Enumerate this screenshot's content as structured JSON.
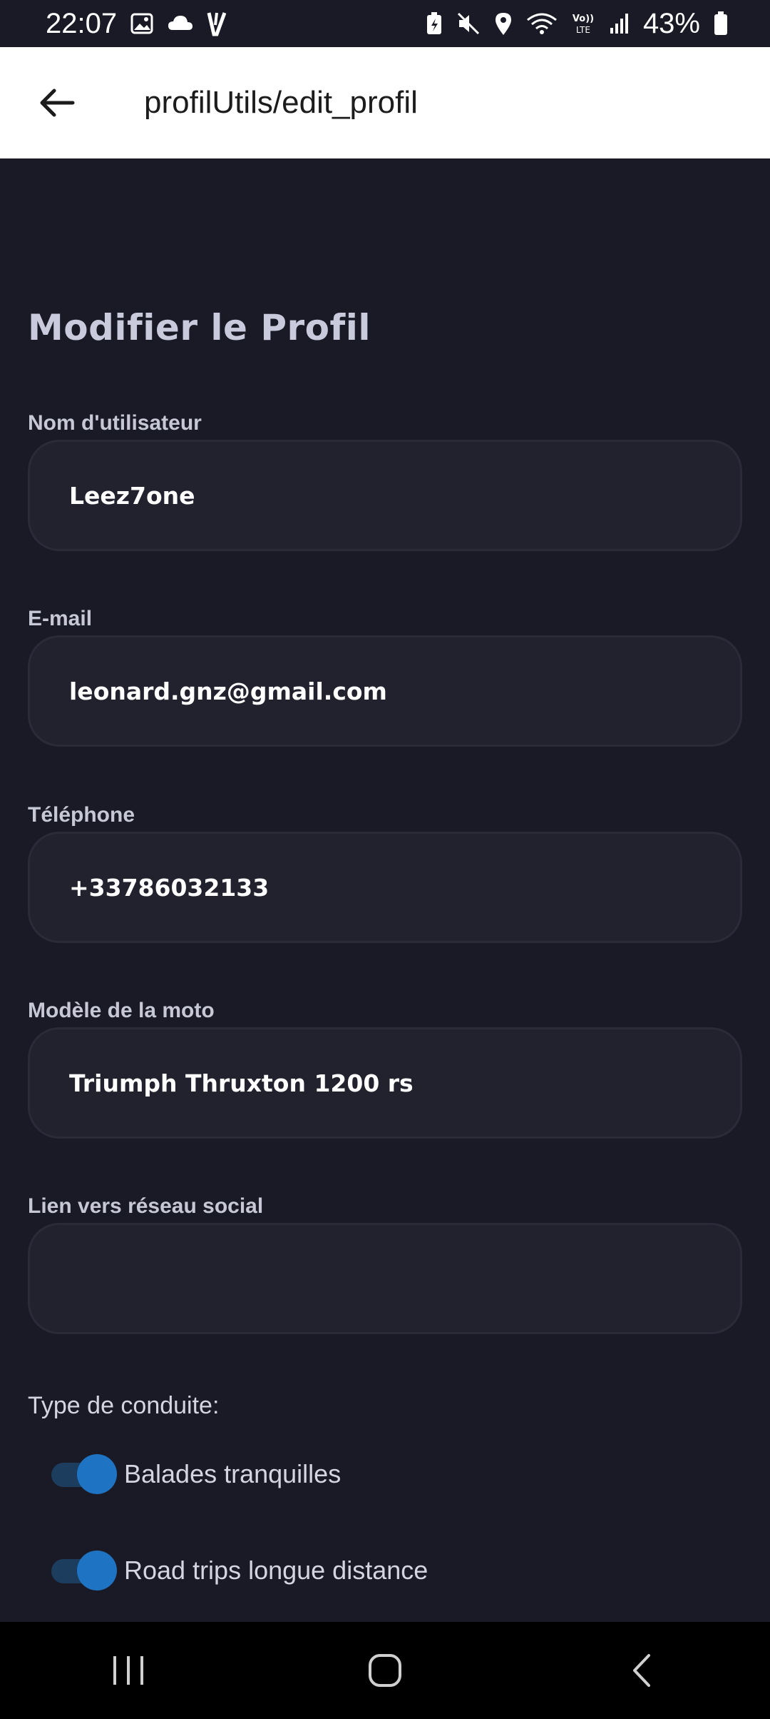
{
  "status_bar": {
    "time": "22:07",
    "network": "VoLTE",
    "battery": "43%",
    "left_icons": [
      "image-icon",
      "cloud-icon",
      "v-app-icon"
    ],
    "right_icons": [
      "battery-saver-icon",
      "mute-icon",
      "location-icon",
      "wifi-icon",
      "volte-icon",
      "signal-icon",
      "battery-icon"
    ]
  },
  "app_bar": {
    "title": "profilUtils/edit_profil",
    "back_icon": "arrow-left-icon"
  },
  "form": {
    "heading": "Modifier le Profil",
    "fields": [
      {
        "label": "Nom d'utilisateur",
        "value": "Leez7one"
      },
      {
        "label": "E-mail",
        "value": "leonard.gnz@gmail.com"
      },
      {
        "label": "Téléphone",
        "value": "+33786032133"
      },
      {
        "label": "Modèle de la moto",
        "value": "Triumph Thruxton 1200 rs"
      },
      {
        "label": "Lien vers réseau social",
        "value": ""
      }
    ],
    "riding_type_label": "Type de conduite:",
    "toggles": [
      {
        "label": "Balades tranquilles",
        "on": true
      },
      {
        "label": "Road trips longue distance",
        "on": true
      }
    ]
  },
  "colors": {
    "background": "#1a1a26",
    "field_bg": "#22222f",
    "accent": "#1e73c2",
    "app_bar": "#ffffff"
  },
  "nav_bar": {
    "icons": [
      "recents-icon",
      "home-icon",
      "back-icon"
    ]
  }
}
